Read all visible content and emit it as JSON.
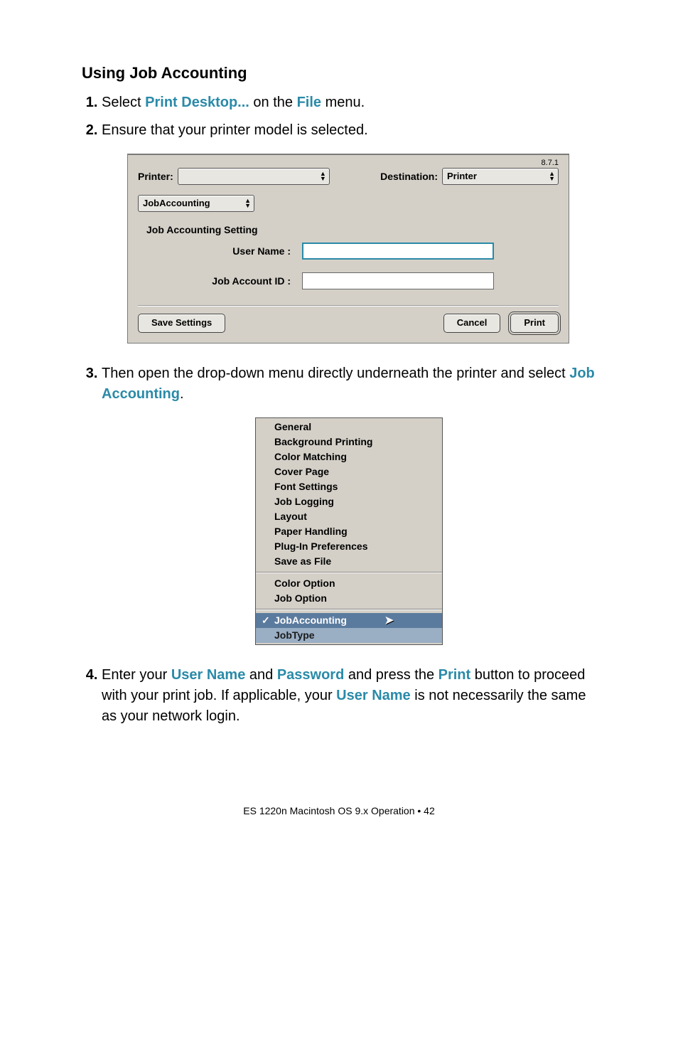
{
  "heading": "Using Job Accounting",
  "steps": {
    "s1": {
      "pre": "Select ",
      "link1": "Print Desktop...",
      "mid": " on the ",
      "link2": "File",
      "post": " menu."
    },
    "s2": {
      "text": "Ensure that your printer model is selected."
    },
    "s3": {
      "pre": "Then open the drop-down menu directly underneath the printer and select ",
      "link": "Job Accounting",
      "post": "."
    },
    "s4": {
      "pre": "Enter your ",
      "l1": "User Name",
      "m1": " and ",
      "l2": "Password",
      "m2": " and press the ",
      "l3": "Print",
      "m3": " button to proceed with your print job. If applicable, your ",
      "l4": "User Name",
      "post": " is not necessarily the same as your network login."
    }
  },
  "dialog": {
    "version": "8.7.1",
    "printer_label": "Printer:",
    "destination_label": "Destination:",
    "destination_value": "Printer",
    "pane_value": "JobAccounting",
    "group_label": "Job Accounting Setting",
    "username_label": "User Name :",
    "jobid_label": "Job Account ID :",
    "save_btn": "Save Settings",
    "cancel_btn": "Cancel",
    "print_btn": "Print"
  },
  "menu": {
    "items_a": [
      "General",
      "Background Printing",
      "Color Matching",
      "Cover Page",
      "Font Settings",
      "Job Logging",
      "Layout",
      "Paper Handling",
      "Plug-In Preferences",
      "Save as File"
    ],
    "items_b": [
      "Color Option",
      "Job Option"
    ],
    "selected": "JobAccounting",
    "sub": "JobType"
  },
  "footer": "ES 1220n Macintosh OS 9.x Operation  • 42"
}
